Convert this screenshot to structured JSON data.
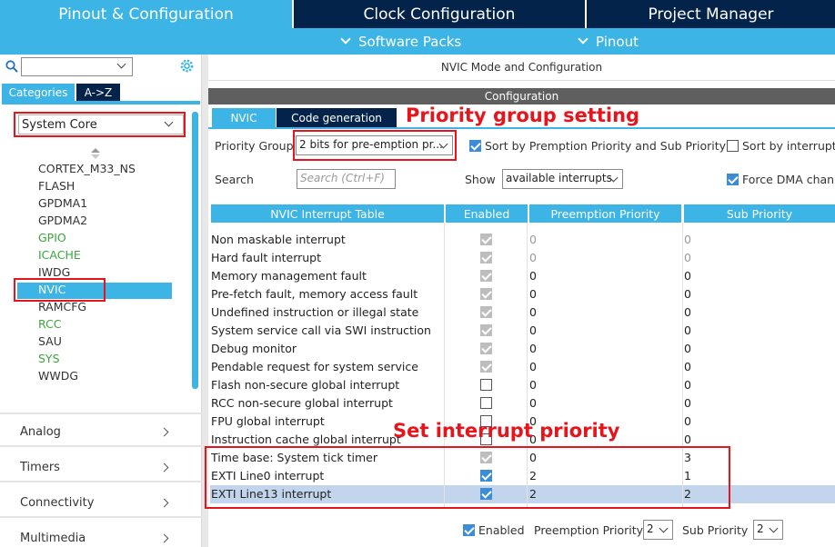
{
  "top_tabs": {
    "pinout": "Pinout & Configuration",
    "clock": "Clock Configuration",
    "project": "Project Manager"
  },
  "sub_bar": {
    "software_packs": "Software Packs",
    "pinout": "Pinout"
  },
  "left": {
    "search_value": "",
    "tab_categories": "Categories",
    "tab_az": "A->Z",
    "system_core": "System Core",
    "components": [
      {
        "label": "CORTEX_M33_NS",
        "color": "#333333"
      },
      {
        "label": "FLASH",
        "color": "#333333"
      },
      {
        "label": "GPDMA1",
        "color": "#333333"
      },
      {
        "label": "GPDMA2",
        "color": "#333333"
      },
      {
        "label": "GPIO",
        "color": "#3aa53a"
      },
      {
        "label": "ICACHE",
        "color": "#3aa53a"
      },
      {
        "label": "IWDG",
        "color": "#333333"
      },
      {
        "label": "NVIC",
        "color": "#ffffff"
      },
      {
        "label": "RAMCFG",
        "color": "#333333"
      },
      {
        "label": "RCC",
        "color": "#3aa53a"
      },
      {
        "label": "SAU",
        "color": "#333333"
      },
      {
        "label": "SYS",
        "color": "#3aa53a"
      },
      {
        "label": "WWDG",
        "color": "#333333"
      }
    ],
    "categories": [
      "Analog",
      "Timers",
      "Connectivity",
      "Multimedia"
    ]
  },
  "right": {
    "mode_title": "NVIC Mode and Configuration",
    "configuration": "Configuration",
    "tab_nvic": "NVIC",
    "tab_codegen": "Code generation",
    "priority_group_label": "Priority Group",
    "priority_group_value": "2 bits for pre-emption pr...",
    "sort_premption": "Sort by Premption Priority and Sub Priority",
    "sort_interrupts": "Sort by interrupts",
    "search_label": "Search",
    "search_placeholder": "Search (Ctrl+F)",
    "show_label": "Show",
    "show_value": "available interrupts",
    "force_dma": "Force DMA chann",
    "table_headers": [
      "NVIC Interrupt Table",
      "Enabled",
      "Preemption Priority",
      "Sub Priority"
    ],
    "rows": [
      {
        "name": "Non maskable interrupt",
        "enabled": true,
        "locked": true,
        "pre": "0",
        "sub": "0",
        "gray": true
      },
      {
        "name": "Hard fault interrupt",
        "enabled": true,
        "locked": true,
        "pre": "0",
        "sub": "0",
        "gray": true
      },
      {
        "name": "Memory management fault",
        "enabled": true,
        "locked": true,
        "pre": "0",
        "sub": "0",
        "gray": false
      },
      {
        "name": "Pre-fetch fault, memory access fault",
        "enabled": true,
        "locked": true,
        "pre": "0",
        "sub": "0",
        "gray": false
      },
      {
        "name": "Undefined instruction or illegal state",
        "enabled": true,
        "locked": true,
        "pre": "0",
        "sub": "0",
        "gray": false
      },
      {
        "name": "System service call via SWI instruction",
        "enabled": true,
        "locked": true,
        "pre": "0",
        "sub": "0",
        "gray": false
      },
      {
        "name": "Debug monitor",
        "enabled": true,
        "locked": true,
        "pre": "0",
        "sub": "0",
        "gray": false
      },
      {
        "name": "Pendable request for system service",
        "enabled": true,
        "locked": true,
        "pre": "0",
        "sub": "0",
        "gray": false
      },
      {
        "name": "Flash non-secure global interrupt",
        "enabled": false,
        "locked": false,
        "pre": "0",
        "sub": "0",
        "gray": false
      },
      {
        "name": "RCC non-secure global interrupt",
        "enabled": false,
        "locked": false,
        "pre": "0",
        "sub": "0",
        "gray": false
      },
      {
        "name": "FPU global interrupt",
        "enabled": false,
        "locked": false,
        "pre": "0",
        "sub": "0",
        "gray": false
      },
      {
        "name": "Instruction cache global interrupt",
        "enabled": false,
        "locked": false,
        "pre": "0",
        "sub": "0",
        "gray": false
      },
      {
        "name": "Time base: System tick timer",
        "enabled": true,
        "locked": true,
        "pre": "0",
        "sub": "3",
        "gray": false
      },
      {
        "name": "EXTI Line0 interrupt",
        "enabled": true,
        "locked": false,
        "pre": "2",
        "sub": "1",
        "gray": false
      },
      {
        "name": "EXTI Line13 interrupt",
        "enabled": true,
        "locked": false,
        "pre": "2",
        "sub": "2",
        "gray": false
      }
    ],
    "footer": {
      "enabled_label": "Enabled",
      "preemption_label": "Preemption Priority",
      "preemption_value": "2",
      "sub_label": "Sub Priority",
      "sub_value": "2"
    }
  },
  "annotations": {
    "priority_group_setting": "Priority group setting",
    "set_interrupt_priority": "Set interrupt priority"
  },
  "colors": {
    "header_dark": "#03234b",
    "accent": "#3cb4e6",
    "annotation_red": "#e8141b",
    "selected_row": "#c3d5ec"
  }
}
